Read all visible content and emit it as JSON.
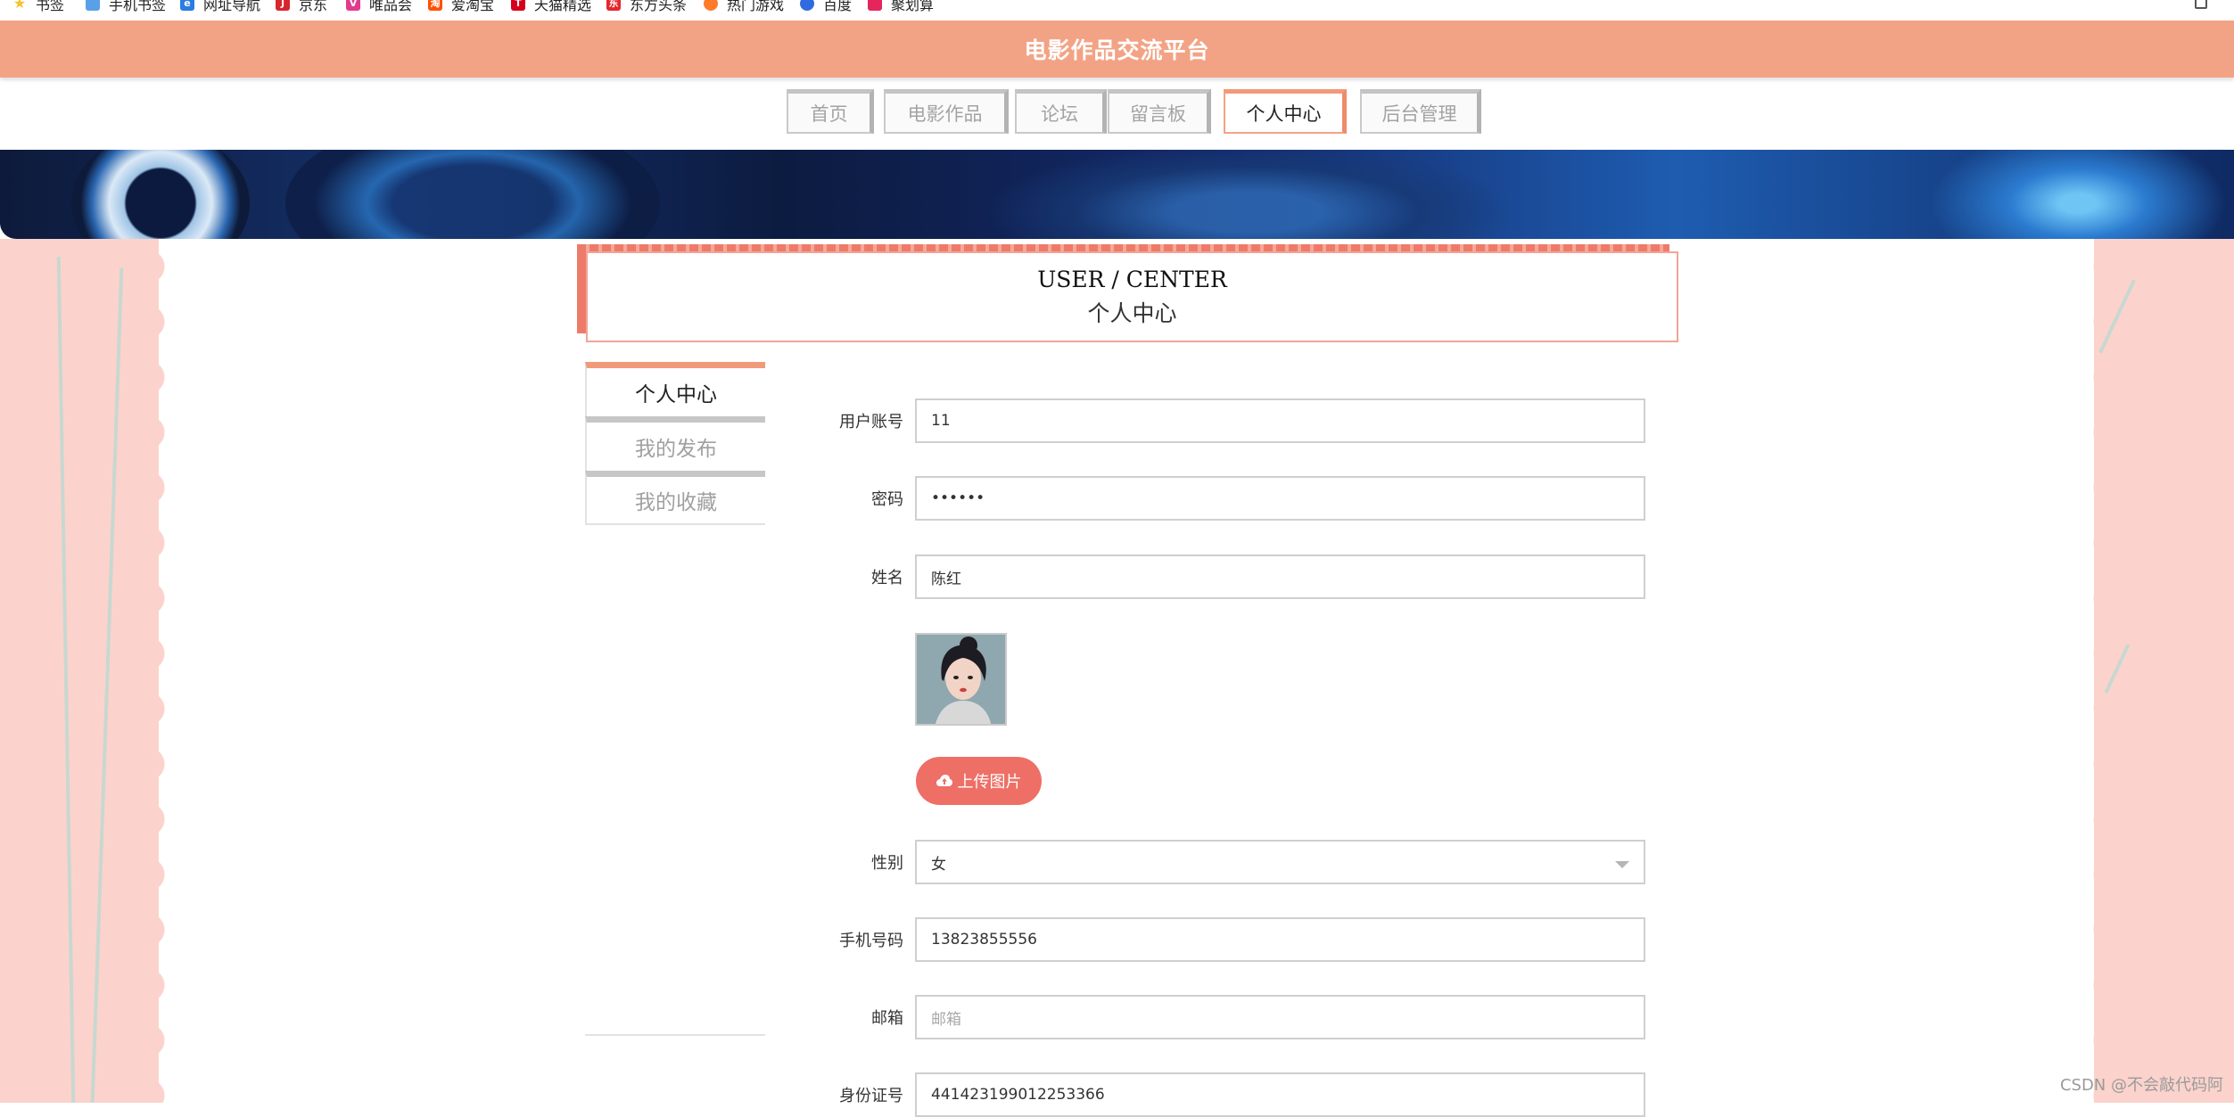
{
  "bookmarks": [
    {
      "label": "书签",
      "icon": "star-icon",
      "color": "#f6c12c"
    },
    {
      "label": "手机书签",
      "icon": "phone-bookmark-icon",
      "color": "#5aa0e6"
    },
    {
      "label": "网址导航",
      "icon": "browser-e-icon",
      "color": "#2a7de1"
    },
    {
      "label": "京东",
      "icon": "jd-logo-icon",
      "color": "#d8262c"
    },
    {
      "label": "唯品会",
      "icon": "vip-logo-icon",
      "color": "#e23b8d"
    },
    {
      "label": "爱淘宝",
      "icon": "taobao-logo-icon",
      "color": "#ff5000"
    },
    {
      "label": "天猫精选",
      "icon": "tmall-logo-icon",
      "color": "#d6001c"
    },
    {
      "label": "东方头条",
      "icon": "toutiao-logo-icon",
      "color": "#e5262d"
    },
    {
      "label": "热门游戏",
      "icon": "game-icon",
      "color": "#ff7a2b"
    },
    {
      "label": "百度",
      "icon": "baidu-logo-icon",
      "color": "#2f6ae0"
    },
    {
      "label": "聚划算",
      "icon": "juhuasuan-logo-icon",
      "color": "#e5265c"
    }
  ],
  "header": {
    "title": "电影作品交流平台"
  },
  "nav": [
    {
      "label": "首页"
    },
    {
      "label": "电影作品"
    },
    {
      "label": "论坛"
    },
    {
      "label": "留言板"
    },
    {
      "label": "个人中心",
      "active": true
    },
    {
      "label": "后台管理"
    }
  ],
  "section": {
    "title_en": "USER / CENTER",
    "title_cn": "个人中心"
  },
  "side_menu": [
    {
      "label": "个人中心",
      "active": true
    },
    {
      "label": "我的发布"
    },
    {
      "label": "我的收藏"
    }
  ],
  "form": {
    "account": {
      "label": "用户账号",
      "value": "11"
    },
    "password": {
      "label": "密码",
      "value": "••••••"
    },
    "name": {
      "label": "姓名",
      "value": "陈红"
    },
    "upload_label": "上传图片",
    "gender": {
      "label": "性别",
      "value": "女"
    },
    "phone": {
      "label": "手机号码",
      "value": "13823855556"
    },
    "email": {
      "label": "邮箱",
      "placeholder": "邮箱"
    },
    "id_card": {
      "label": "身份证号",
      "value": "441423199012253366"
    }
  },
  "watermark": "CSDN @不会敲代码阿",
  "colors": {
    "header_bg": "#f3a385",
    "accent": "#ee6f66",
    "page_bg": "#fbd3cc"
  }
}
